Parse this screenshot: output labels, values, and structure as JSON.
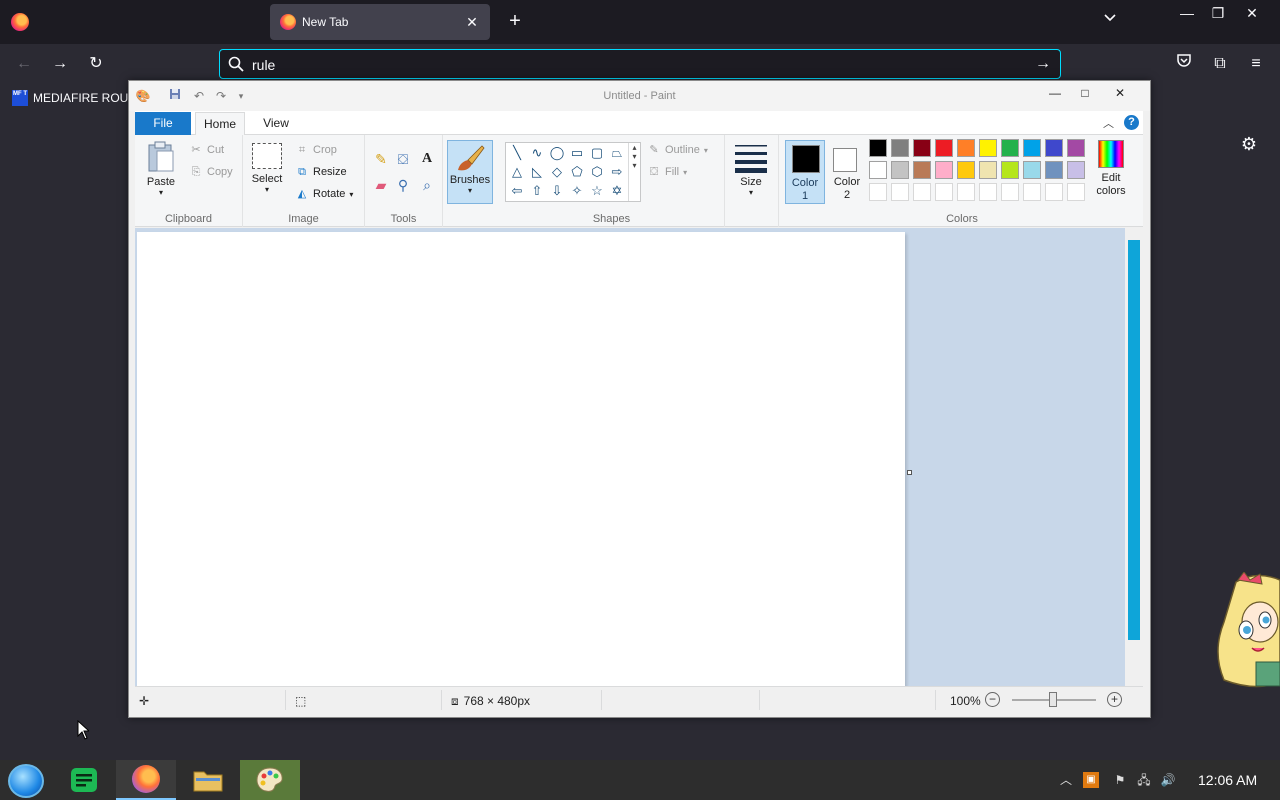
{
  "browser": {
    "tab": {
      "title": "New Tab"
    },
    "url": {
      "value": "rule"
    },
    "bookmark": {
      "label": "MEDIAFIRE ROULE",
      "icon_text": "MF T"
    }
  },
  "paint": {
    "title": "Untitled - Paint",
    "tabs": {
      "file": "File",
      "home": "Home",
      "view": "View"
    },
    "clipboard": {
      "paste": "Paste",
      "cut": "Cut",
      "copy": "Copy",
      "label": "Clipboard"
    },
    "image": {
      "select": "Select",
      "crop": "Crop",
      "resize": "Resize",
      "rotate": "Rotate",
      "label": "Image"
    },
    "tools": {
      "label": "Tools"
    },
    "brushes": {
      "label": "Brushes"
    },
    "shapes": {
      "outline": "Outline",
      "fill": "Fill",
      "label": "Shapes"
    },
    "size": {
      "label": "Size"
    },
    "colors": {
      "color1": "Color\n1",
      "color2": "Color\n2",
      "edit": "Edit colors",
      "label": "Colors",
      "color1_value": "#000000",
      "color2_value": "#ffffff",
      "palette_row1": [
        "#000000",
        "#7f7f7f",
        "#880015",
        "#ed1c24",
        "#ff7f27",
        "#fff200",
        "#22b14c",
        "#00a2e8",
        "#3f48cc",
        "#a349a4"
      ],
      "palette_row2": [
        "#ffffff",
        "#c3c3c3",
        "#b97a57",
        "#ffaec9",
        "#ffc90e",
        "#efe4b0",
        "#b5e61d",
        "#99d9ea",
        "#7092be",
        "#c8bfe7"
      ]
    },
    "status": {
      "dimensions": "768 × 480px",
      "zoom": "100%"
    }
  },
  "taskbar": {
    "clock": "12:06 AM"
  }
}
